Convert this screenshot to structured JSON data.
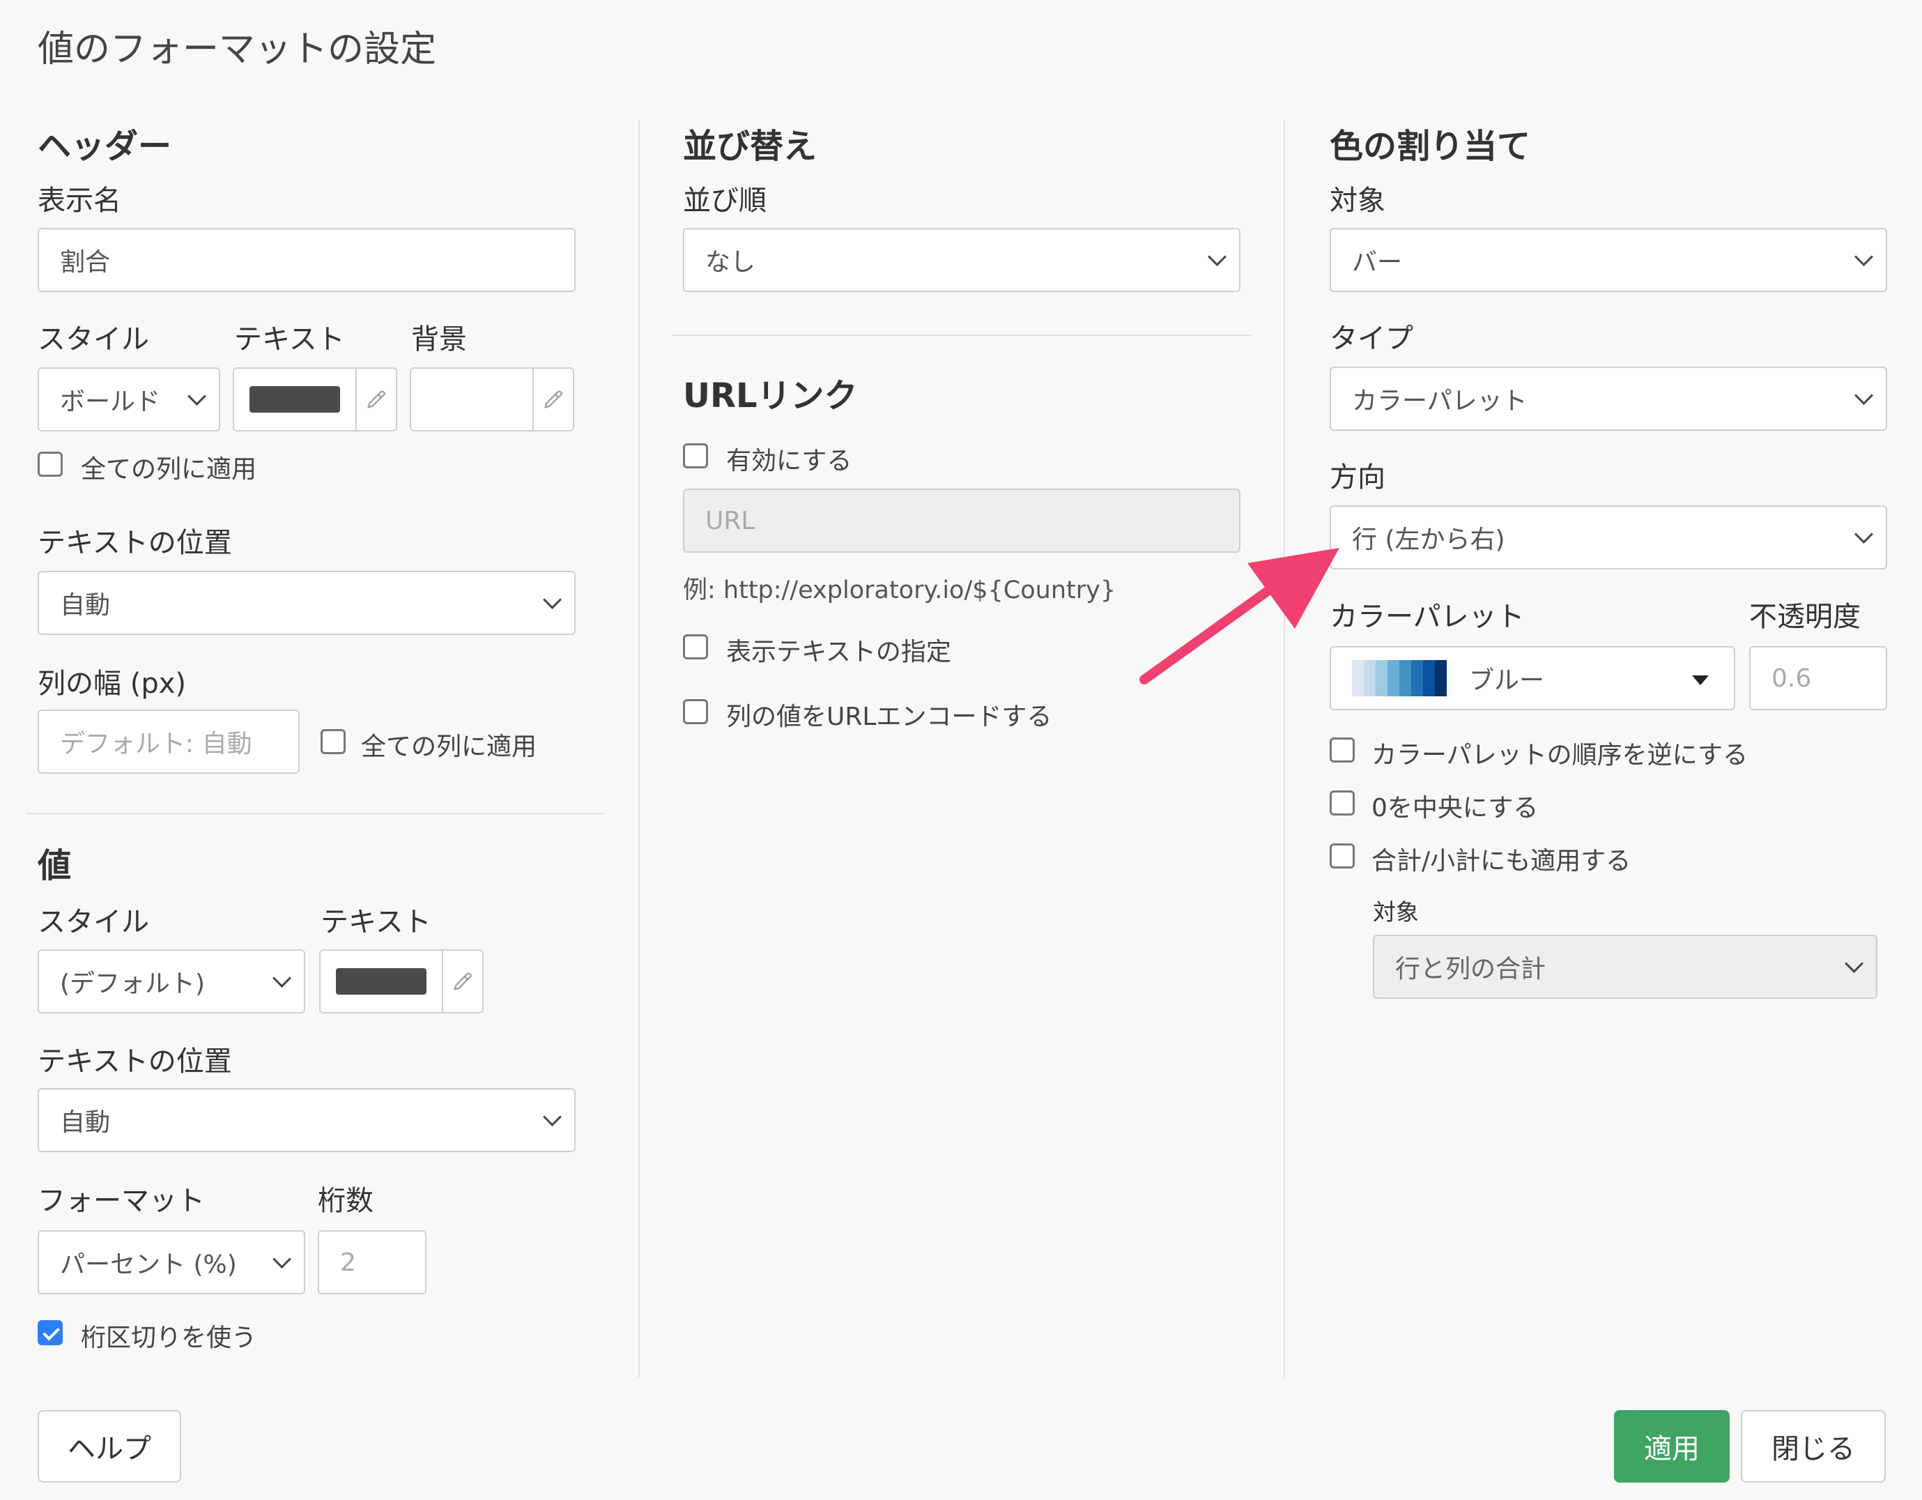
{
  "dialog": {
    "title": "値のフォーマットの設定"
  },
  "header_section": {
    "heading": "ヘッダー",
    "display_name_label": "表示名",
    "display_name_value": "割合",
    "style_label": "スタイル",
    "text_label": "テキスト",
    "background_label": "背景",
    "style_value": "ボールド",
    "text_color": "#4a4a4a",
    "apply_all_cols": "全ての列に適用",
    "text_position_label": "テキストの位置",
    "text_position_value": "自動",
    "col_width_label": "列の幅 (px)",
    "col_width_placeholder": "デフォルト: 自動",
    "col_width_apply_all": "全ての列に適用"
  },
  "value_section": {
    "heading": "値",
    "style_label": "スタイル",
    "text_label": "テキスト",
    "style_value": "(デフォルト)",
    "text_color": "#4a4a4a",
    "text_position_label": "テキストの位置",
    "text_position_value": "自動",
    "format_label": "フォーマット",
    "digits_label": "桁数",
    "format_value": "パーセント (%)",
    "digits_placeholder": "2",
    "use_separator": "桁区切りを使う",
    "use_separator_checked": true
  },
  "sort_section": {
    "heading": "並び替え",
    "order_label": "並び順",
    "order_value": "なし"
  },
  "url_section": {
    "heading": "URLリンク",
    "enable": "有効にする",
    "url_placeholder": "URL",
    "example": "例: http://exploratory.io/${Country}",
    "specify_text": "表示テキストの指定",
    "url_encode": "列の値をURLエンコードする"
  },
  "color_section": {
    "heading": "色の割り当て",
    "target_label": "対象",
    "target_value": "バー",
    "type_label": "タイプ",
    "type_value": "カラーパレット",
    "direction_label": "方向",
    "direction_value": "行 (左から右)",
    "palette_label": "カラーパレット",
    "opacity_label": "不透明度",
    "palette_value": "ブルー",
    "opacity_value": "0.6",
    "palette_colors": [
      "#dce9f5",
      "#c6dbef",
      "#9ecae1",
      "#6baed6",
      "#4292c6",
      "#2171b5",
      "#08519c",
      "#08306b"
    ],
    "reverse": "カラーパレットの順序を逆にする",
    "center_zero": "0を中央にする",
    "apply_totals": "合計/小計にも適用する",
    "sub_target_label": "対象",
    "sub_target_value": "行と列の合計"
  },
  "footer": {
    "help": "ヘルプ",
    "apply": "適用",
    "close": "閉じる"
  },
  "annotation": {
    "arrow_color": "#ee4170"
  }
}
